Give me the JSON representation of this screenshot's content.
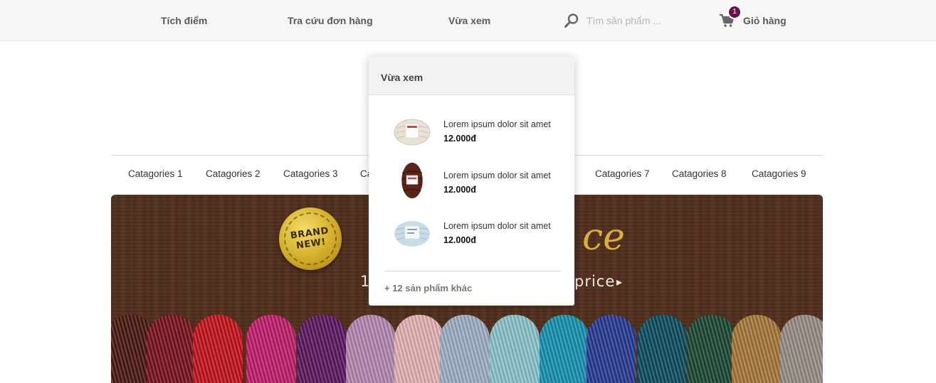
{
  "topbar": {
    "links": [
      {
        "label": "Tích điểm"
      },
      {
        "label": "Tra cứu đơn hàng"
      },
      {
        "label": "Vừa xem"
      }
    ],
    "search": {
      "placeholder": "Tìm sản phẩm ...",
      "icon": "search-icon"
    },
    "cart": {
      "label": "Giỏ hàng",
      "count": "1",
      "icon": "cart-icon",
      "badge_color": "#6b0f4e"
    }
  },
  "categories": [
    {
      "label": "Catagories 1"
    },
    {
      "label": "Catagories 2"
    },
    {
      "label": "Catagories 3"
    },
    {
      "label": "Ca"
    },
    {
      "label": "Catagories 7"
    },
    {
      "label": "Catagories 8"
    },
    {
      "label": "Catagories 9"
    }
  ],
  "banner": {
    "seal_line1": "BRAND",
    "seal_line2": "NEW!",
    "script_text": "ce",
    "line_left": "1",
    "line_right": "price",
    "arrow": "▸"
  },
  "recently_viewed": {
    "title": "Vừa xem",
    "items": [
      {
        "name": "Lorem ipsum dolor sit amet",
        "price": "12.000đ",
        "color": "#e9e1d6"
      },
      {
        "name": "Lorem ipsum dolor sit amet",
        "price": "12.000đ",
        "color": "#5a2418"
      },
      {
        "name": "Lorem ipsum dolor sit amet",
        "price": "12.000đ",
        "color": "#c9dbe6"
      }
    ],
    "more": "+ 12 sản phẩm khác"
  }
}
